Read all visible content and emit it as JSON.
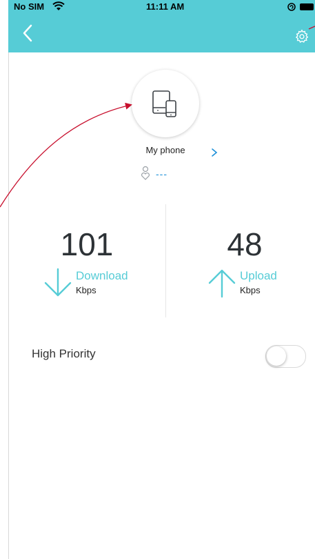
{
  "status_bar": {
    "carrier": "No SIM",
    "time": "11:11 AM"
  },
  "nav": {
    "back_icon": "chevron-left-icon",
    "settings_icon": "gear-icon"
  },
  "device": {
    "icon": "tablet-phone-icon",
    "name": "My phone",
    "owner_icon": "person-heart-icon",
    "owner": "---"
  },
  "speeds": {
    "download": {
      "value": "101",
      "label": "Download",
      "unit": "Kbps",
      "icon": "arrow-down-icon"
    },
    "upload": {
      "value": "48",
      "label": "Upload",
      "unit": "Kbps",
      "icon": "arrow-up-icon"
    }
  },
  "priority": {
    "label": "High Priority",
    "enabled": false
  },
  "colors": {
    "accent": "#56ccd6",
    "text_dark": "#2d3236",
    "link": "#1b8fd8",
    "annotation": "#c8102e"
  }
}
